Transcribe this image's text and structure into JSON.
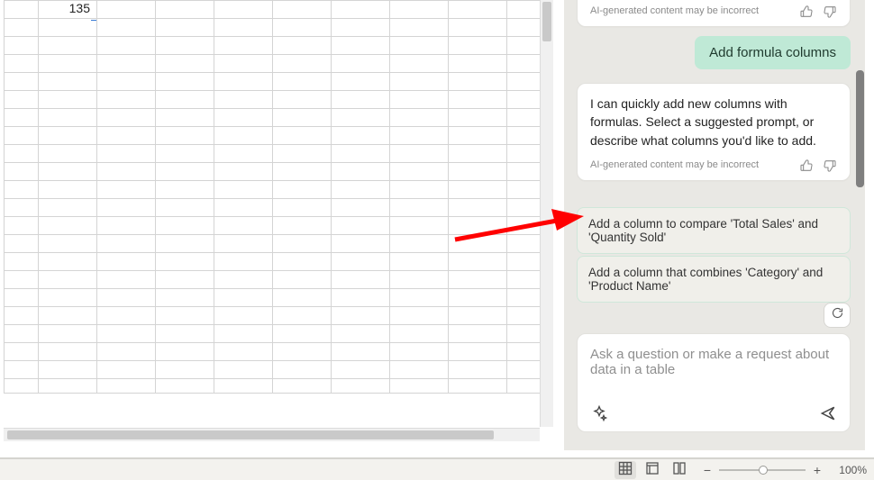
{
  "sheet": {
    "visible_cells": {
      "r1c2": "135"
    }
  },
  "copilot": {
    "prev_disclaimer": "AI-generated content may be incorrect",
    "user_message": "Add formula columns",
    "assistant_message": "I can quickly add new columns with formulas. Select a suggested prompt, or describe what columns you'd like to add.",
    "assistant_disclaimer": "AI-generated content may be incorrect",
    "suggestions": [
      "Add a column to compare 'Total Sales' and 'Quantity Sold'",
      "Add a column that combines 'Category' and 'Product Name'"
    ],
    "input_placeholder": "Ask a question or make a request about data in a table"
  },
  "status_bar": {
    "zoom_pct": "100%"
  },
  "colors": {
    "user_bubble_bg": "#bfe9d6",
    "suggestion_border": "#cfe7da",
    "panel_bg": "#e9e8e4"
  }
}
